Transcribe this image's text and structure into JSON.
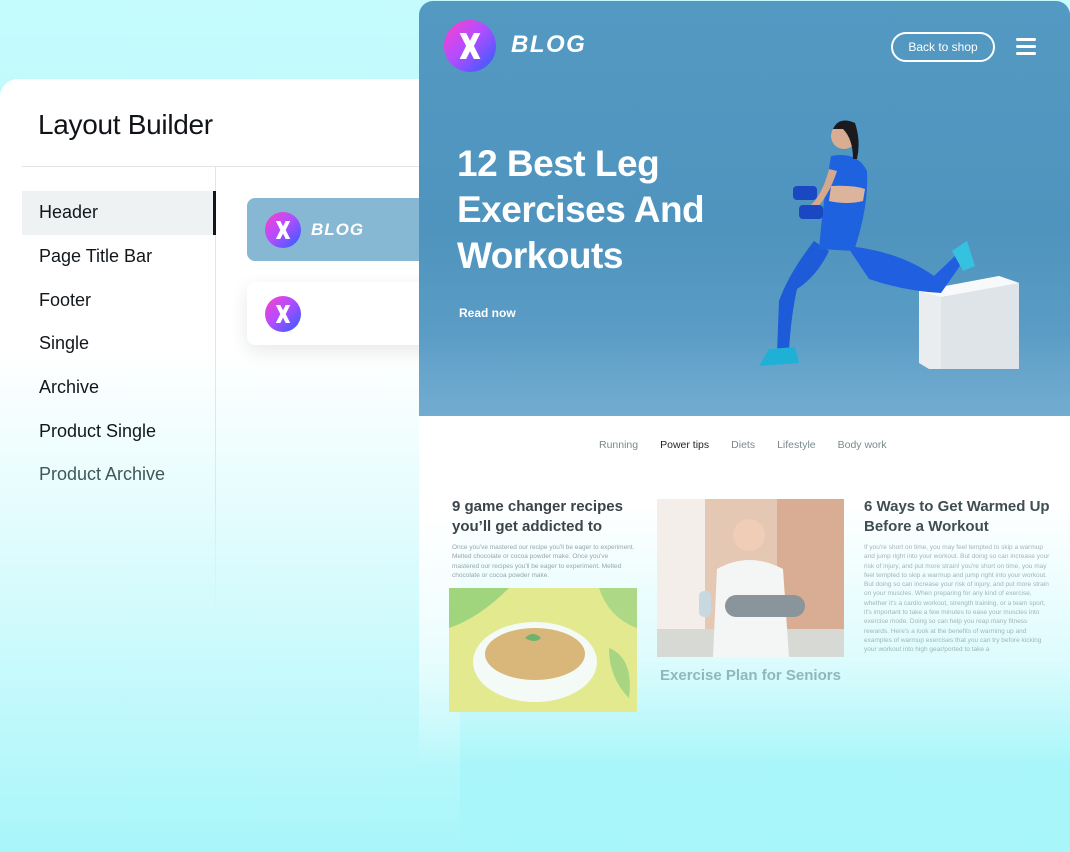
{
  "builder": {
    "title": "Layout Builder",
    "nav": [
      {
        "label": "Header",
        "active": true
      },
      {
        "label": "Page Title Bar"
      },
      {
        "label": "Footer"
      },
      {
        "label": "Single"
      },
      {
        "label": "Archive"
      },
      {
        "label": "Product Single"
      },
      {
        "label": "Product Archive"
      }
    ],
    "card_blue_label": "BLOG"
  },
  "preview": {
    "brand": "BLOG",
    "back_to_shop": "Back to shop",
    "hero_title": "12 Best Leg Exercises And Workouts",
    "read_now": "Read now",
    "tabs": [
      "Running",
      "Power tips",
      "Diets",
      "Lifestyle",
      "Body work"
    ],
    "active_tab": "Power tips",
    "article_left": {
      "title": "9 game changer recipes you’ll get addicted to",
      "body": "Once you've mastered our recipe you'll be eager to experiment. Melted chocolate or cocoa powder make. Once you've mastered our recipes you'll be eager to experiment. Melted chocolate or cocoa powder make."
    },
    "article_middle": {
      "caption": "Exercise Plan for Seniors"
    },
    "article_right": {
      "title": "6 Ways to Get Warmed Up Before a Workout",
      "body": "If you're short on time, you may feel tempted to skip a warmup and jump right into your workout. But doing so can increase your risk of injury, and put more strain! you're short on time, you may feel tempted to skip a warmup and jump right into your workout. But doing so can increase your risk of injury, and put more strain on your muscles. When preparing for any kind of exercise, whether it's a cardio workout, strength training, or a team sport, it's important to take a few minutes to ease your muscles into exercise mode. Doing so can help you reap many fitness rewards. Here's a look at the benefits of warming up and examples of warmup exercises that you can try before kicking your workout into high gear/ported to take a"
    }
  },
  "colors": {
    "hero_blue": "#5399c2",
    "card_blue": "#86b8d3",
    "background_cyan": "#b4f8fb"
  },
  "icons": [
    "x-logo-icon",
    "hamburger-menu-icon"
  ]
}
